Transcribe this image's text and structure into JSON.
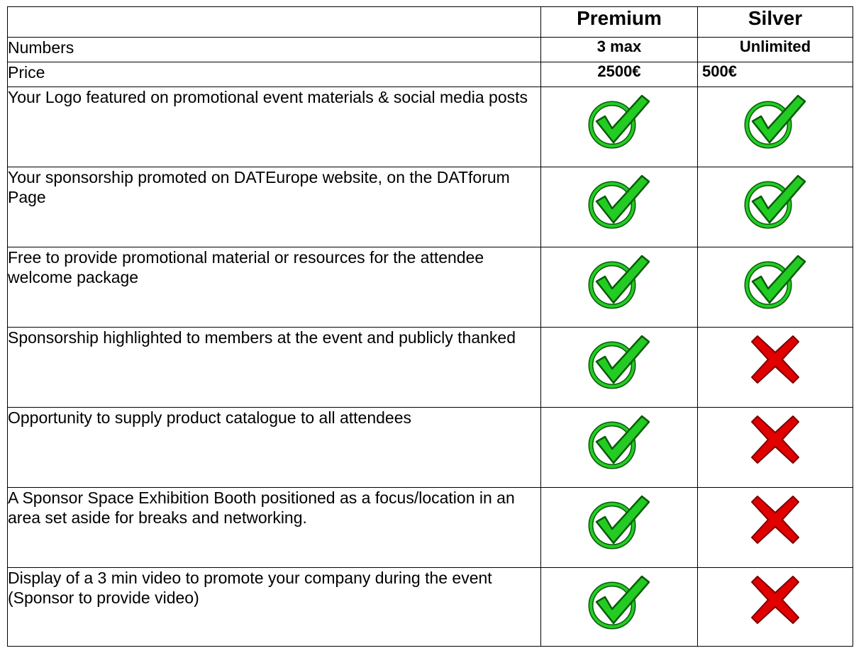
{
  "colors": {
    "check_green": "#22cc22",
    "check_outline": "#0a5a0a",
    "cross_red": "#e00000",
    "cross_outline": "#7a0000",
    "border": "#000000"
  },
  "header": {
    "blank": "",
    "premium": "Premium",
    "silver": "Silver"
  },
  "rows_simple": [
    {
      "label": "Numbers",
      "premium": "3 max",
      "silver": "Unlimited"
    },
    {
      "label": "Price",
      "premium": "2500€",
      "silver": "500€"
    }
  ],
  "features": [
    {
      "text": "Your Logo featured on promotional event materials & social media posts",
      "premium": "check",
      "silver": "check"
    },
    {
      "text": "Your sponsorship promoted on DATEurope website, on the DATforum Page",
      "premium": "check",
      "silver": "check"
    },
    {
      "text": "Free to provide promotional material or resources for the attendee welcome package",
      "premium": "check",
      "silver": "check"
    },
    {
      "text": "Sponsorship highlighted to members at the event and publicly thanked",
      "premium": "check",
      "silver": "cross"
    },
    {
      "text": "Opportunity to supply product catalogue to all attendees",
      "premium": "check",
      "silver": "cross"
    },
    {
      "text": "A Sponsor Space Exhibition Booth positioned as a focus/location in an area set aside for breaks and networking.",
      "premium": "check",
      "silver": "cross"
    },
    {
      "text": "Display of a 3 min video to promote your company during the event (Sponsor to provide video)",
      "premium": "check",
      "silver": "cross"
    }
  ]
}
